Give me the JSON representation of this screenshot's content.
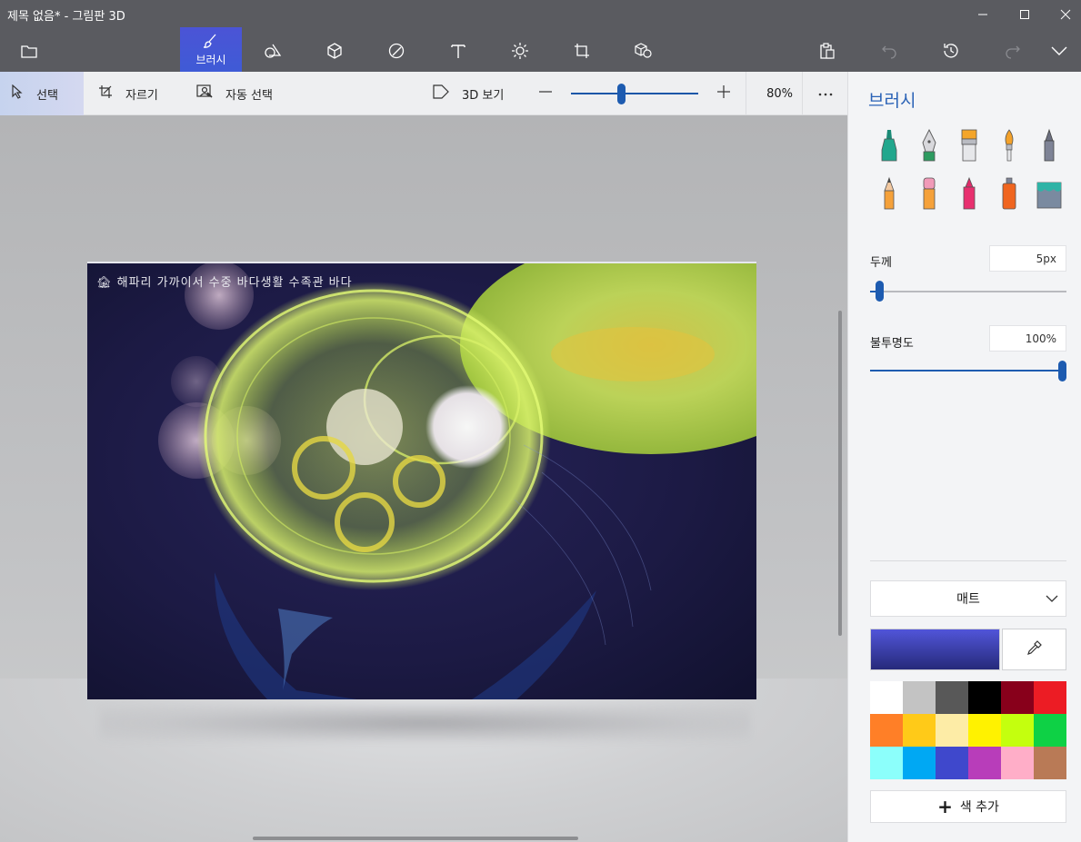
{
  "window": {
    "title": "제목 없음* - 그림판 3D"
  },
  "toolbar": {
    "active_tool_label": "브러시",
    "icons": [
      "folder-icon",
      "brush-icon",
      "shapes-2d-icon",
      "shapes-3d-icon",
      "stickers-icon",
      "text-icon",
      "effects-icon",
      "canvas-icon",
      "library-3d-icon",
      "paste-icon",
      "undo-icon",
      "history-icon",
      "redo-icon",
      "expand-icon"
    ]
  },
  "subtoolbar": {
    "select_label": "선택",
    "crop_label": "자르기",
    "magic_select_label": "자동 선택",
    "view3d_label": "3D 보기",
    "zoom_value": "80%",
    "zoom_percent": 80
  },
  "canvas": {
    "watermark": "🏚 해파리 가까이서 수중 바다생활 수족관 바다"
  },
  "panel": {
    "title": "브러시",
    "brushes": [
      "marker",
      "calligraphy-pen",
      "oil-brush",
      "watercolor",
      "pixel-pen",
      "pencil",
      "eraser",
      "crayon",
      "spraycan",
      "fill"
    ],
    "thickness_label": "두께",
    "thickness_value": "5px",
    "opacity_label": "불투명도",
    "opacity_value": "100%",
    "finish_label": "매트",
    "current_color": [
      "#5155d9",
      "#262a7a"
    ],
    "add_color_label": "색 추가",
    "palette": [
      "#ffffff",
      "#c3c3c3",
      "#585858",
      "#000000",
      "#88001b",
      "#ec1c24",
      "#ff7f27",
      "#ffca18",
      "#fdeca6",
      "#fff200",
      "#c4ff0e",
      "#0ed145",
      "#8cfffb",
      "#00a8f3",
      "#3f48cc",
      "#b83dba",
      "#ffaec8",
      "#b97a56"
    ]
  }
}
